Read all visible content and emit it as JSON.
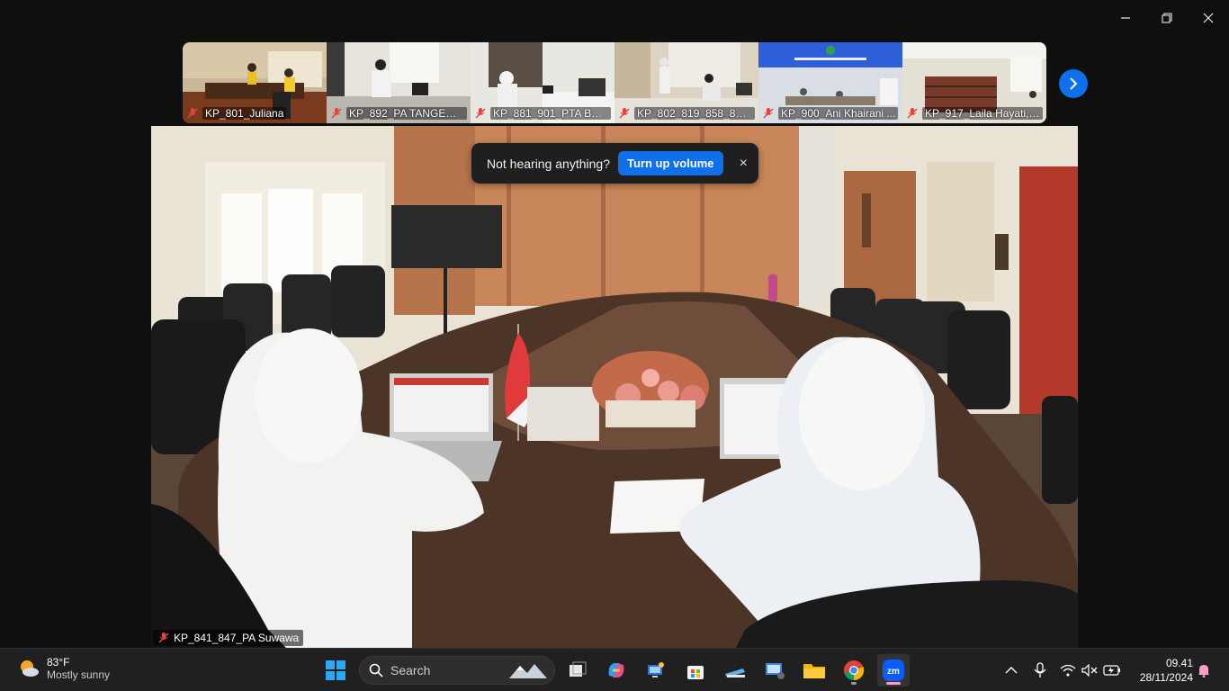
{
  "window": {
    "controls": [
      "minimize-icon",
      "restore-icon",
      "close-icon"
    ]
  },
  "gallery": {
    "participants": [
      {
        "name": "KP_801_Juliana"
      },
      {
        "name": "KP_892_PA TANGERA..."
      },
      {
        "name": "KP_881_901_PTA BAN..."
      },
      {
        "name": "KP_802_819_858_860_..."
      },
      {
        "name": "KP_900_Ani Khairani ..."
      },
      {
        "name": "KP_917_Laila Hayati, ..."
      }
    ],
    "next_icon": "chevron-right-icon"
  },
  "speaker": {
    "name": "KP_841_847_PA Suwawa"
  },
  "audio_prompt": {
    "message": "Not hearing anything?",
    "action": "Turn up volume",
    "close": "×"
  },
  "taskbar": {
    "weather": {
      "temp": "83°F",
      "condition": "Mostly sunny"
    },
    "search_label": "Search",
    "clock": {
      "time": "09.41",
      "date": "28/11/2024"
    }
  },
  "colors": {
    "accent": "#0e71eb",
    "taskbar_bg": "#202020",
    "muted_mic": "#e0473c"
  }
}
